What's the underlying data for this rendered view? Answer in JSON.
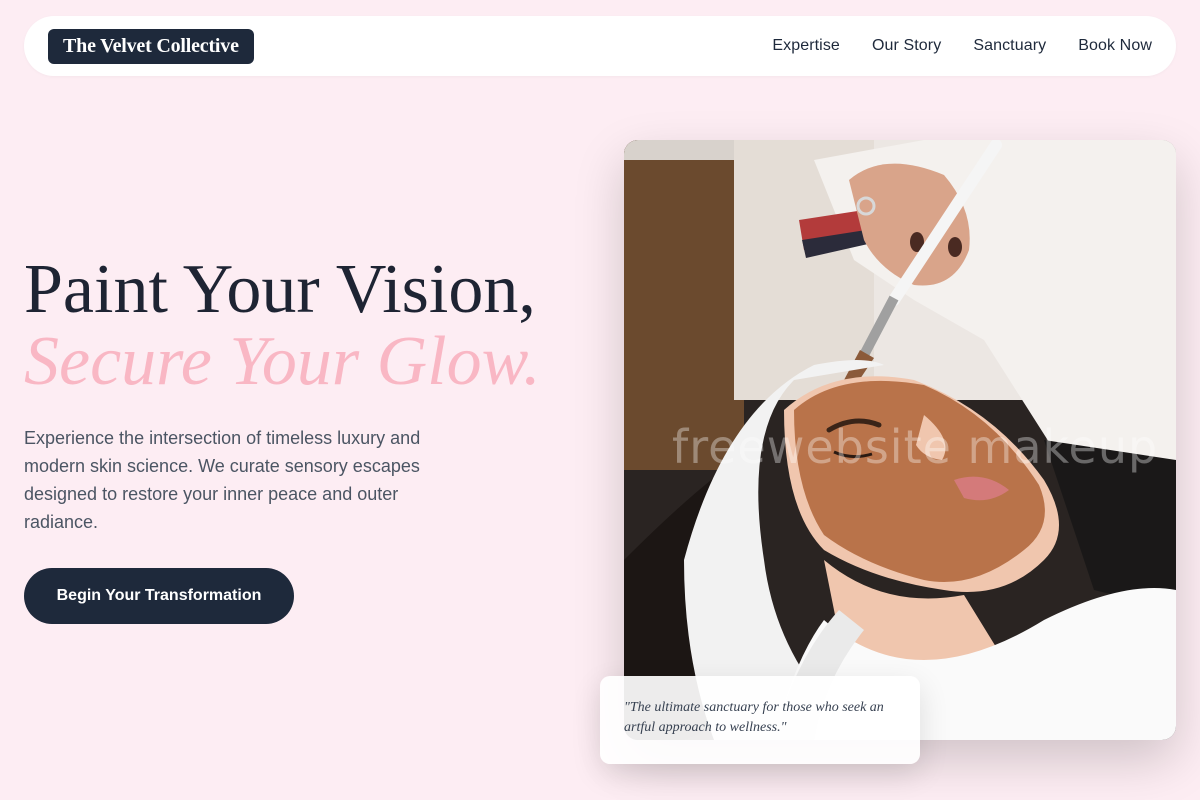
{
  "brand": {
    "name": "The Velvet Collective"
  },
  "nav": {
    "links": [
      "Expertise",
      "Our Story",
      "Sanctuary",
      "Book Now"
    ]
  },
  "hero": {
    "title_line1": "Paint Your Vision,",
    "title_line2": "Secure Your Glow.",
    "description": "Experience the intersection of timeless luxury and modern skin science. We curate sensory escapes designed to restore your inner peace and outer radiance.",
    "cta_label": "Begin Your Transformation"
  },
  "image": {
    "watermark": "freewebsite makeup"
  },
  "quote": {
    "text": "\"The ultimate sanctuary for those who seek an artful approach to wellness.\""
  },
  "colors": {
    "background": "#fdedf3",
    "navy": "#1e293b",
    "pink_accent": "#f9b7c4"
  }
}
